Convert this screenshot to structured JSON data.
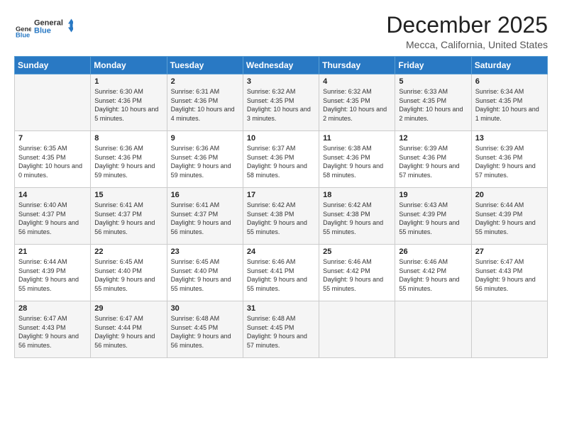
{
  "header": {
    "logo_line1": "General",
    "logo_line2": "Blue",
    "title": "December 2025",
    "subtitle": "Mecca, California, United States"
  },
  "days_of_week": [
    "Sunday",
    "Monday",
    "Tuesday",
    "Wednesday",
    "Thursday",
    "Friday",
    "Saturday"
  ],
  "weeks": [
    [
      {
        "day": "",
        "sunrise": "",
        "sunset": "",
        "daylight": ""
      },
      {
        "day": "1",
        "sunrise": "Sunrise: 6:30 AM",
        "sunset": "Sunset: 4:36 PM",
        "daylight": "Daylight: 10 hours and 5 minutes."
      },
      {
        "day": "2",
        "sunrise": "Sunrise: 6:31 AM",
        "sunset": "Sunset: 4:36 PM",
        "daylight": "Daylight: 10 hours and 4 minutes."
      },
      {
        "day": "3",
        "sunrise": "Sunrise: 6:32 AM",
        "sunset": "Sunset: 4:35 PM",
        "daylight": "Daylight: 10 hours and 3 minutes."
      },
      {
        "day": "4",
        "sunrise": "Sunrise: 6:32 AM",
        "sunset": "Sunset: 4:35 PM",
        "daylight": "Daylight: 10 hours and 2 minutes."
      },
      {
        "day": "5",
        "sunrise": "Sunrise: 6:33 AM",
        "sunset": "Sunset: 4:35 PM",
        "daylight": "Daylight: 10 hours and 2 minutes."
      },
      {
        "day": "6",
        "sunrise": "Sunrise: 6:34 AM",
        "sunset": "Sunset: 4:35 PM",
        "daylight": "Daylight: 10 hours and 1 minute."
      }
    ],
    [
      {
        "day": "7",
        "sunrise": "Sunrise: 6:35 AM",
        "sunset": "Sunset: 4:35 PM",
        "daylight": "Daylight: 10 hours and 0 minutes."
      },
      {
        "day": "8",
        "sunrise": "Sunrise: 6:36 AM",
        "sunset": "Sunset: 4:36 PM",
        "daylight": "Daylight: 9 hours and 59 minutes."
      },
      {
        "day": "9",
        "sunrise": "Sunrise: 6:36 AM",
        "sunset": "Sunset: 4:36 PM",
        "daylight": "Daylight: 9 hours and 59 minutes."
      },
      {
        "day": "10",
        "sunrise": "Sunrise: 6:37 AM",
        "sunset": "Sunset: 4:36 PM",
        "daylight": "Daylight: 9 hours and 58 minutes."
      },
      {
        "day": "11",
        "sunrise": "Sunrise: 6:38 AM",
        "sunset": "Sunset: 4:36 PM",
        "daylight": "Daylight: 9 hours and 58 minutes."
      },
      {
        "day": "12",
        "sunrise": "Sunrise: 6:39 AM",
        "sunset": "Sunset: 4:36 PM",
        "daylight": "Daylight: 9 hours and 57 minutes."
      },
      {
        "day": "13",
        "sunrise": "Sunrise: 6:39 AM",
        "sunset": "Sunset: 4:36 PM",
        "daylight": "Daylight: 9 hours and 57 minutes."
      }
    ],
    [
      {
        "day": "14",
        "sunrise": "Sunrise: 6:40 AM",
        "sunset": "Sunset: 4:37 PM",
        "daylight": "Daylight: 9 hours and 56 minutes."
      },
      {
        "day": "15",
        "sunrise": "Sunrise: 6:41 AM",
        "sunset": "Sunset: 4:37 PM",
        "daylight": "Daylight: 9 hours and 56 minutes."
      },
      {
        "day": "16",
        "sunrise": "Sunrise: 6:41 AM",
        "sunset": "Sunset: 4:37 PM",
        "daylight": "Daylight: 9 hours and 56 minutes."
      },
      {
        "day": "17",
        "sunrise": "Sunrise: 6:42 AM",
        "sunset": "Sunset: 4:38 PM",
        "daylight": "Daylight: 9 hours and 55 minutes."
      },
      {
        "day": "18",
        "sunrise": "Sunrise: 6:42 AM",
        "sunset": "Sunset: 4:38 PM",
        "daylight": "Daylight: 9 hours and 55 minutes."
      },
      {
        "day": "19",
        "sunrise": "Sunrise: 6:43 AM",
        "sunset": "Sunset: 4:39 PM",
        "daylight": "Daylight: 9 hours and 55 minutes."
      },
      {
        "day": "20",
        "sunrise": "Sunrise: 6:44 AM",
        "sunset": "Sunset: 4:39 PM",
        "daylight": "Daylight: 9 hours and 55 minutes."
      }
    ],
    [
      {
        "day": "21",
        "sunrise": "Sunrise: 6:44 AM",
        "sunset": "Sunset: 4:39 PM",
        "daylight": "Daylight: 9 hours and 55 minutes."
      },
      {
        "day": "22",
        "sunrise": "Sunrise: 6:45 AM",
        "sunset": "Sunset: 4:40 PM",
        "daylight": "Daylight: 9 hours and 55 minutes."
      },
      {
        "day": "23",
        "sunrise": "Sunrise: 6:45 AM",
        "sunset": "Sunset: 4:40 PM",
        "daylight": "Daylight: 9 hours and 55 minutes."
      },
      {
        "day": "24",
        "sunrise": "Sunrise: 6:46 AM",
        "sunset": "Sunset: 4:41 PM",
        "daylight": "Daylight: 9 hours and 55 minutes."
      },
      {
        "day": "25",
        "sunrise": "Sunrise: 6:46 AM",
        "sunset": "Sunset: 4:42 PM",
        "daylight": "Daylight: 9 hours and 55 minutes."
      },
      {
        "day": "26",
        "sunrise": "Sunrise: 6:46 AM",
        "sunset": "Sunset: 4:42 PM",
        "daylight": "Daylight: 9 hours and 55 minutes."
      },
      {
        "day": "27",
        "sunrise": "Sunrise: 6:47 AM",
        "sunset": "Sunset: 4:43 PM",
        "daylight": "Daylight: 9 hours and 56 minutes."
      }
    ],
    [
      {
        "day": "28",
        "sunrise": "Sunrise: 6:47 AM",
        "sunset": "Sunset: 4:43 PM",
        "daylight": "Daylight: 9 hours and 56 minutes."
      },
      {
        "day": "29",
        "sunrise": "Sunrise: 6:47 AM",
        "sunset": "Sunset: 4:44 PM",
        "daylight": "Daylight: 9 hours and 56 minutes."
      },
      {
        "day": "30",
        "sunrise": "Sunrise: 6:48 AM",
        "sunset": "Sunset: 4:45 PM",
        "daylight": "Daylight: 9 hours and 56 minutes."
      },
      {
        "day": "31",
        "sunrise": "Sunrise: 6:48 AM",
        "sunset": "Sunset: 4:45 PM",
        "daylight": "Daylight: 9 hours and 57 minutes."
      },
      {
        "day": "",
        "sunrise": "",
        "sunset": "",
        "daylight": ""
      },
      {
        "day": "",
        "sunrise": "",
        "sunset": "",
        "daylight": ""
      },
      {
        "day": "",
        "sunrise": "",
        "sunset": "",
        "daylight": ""
      }
    ]
  ]
}
